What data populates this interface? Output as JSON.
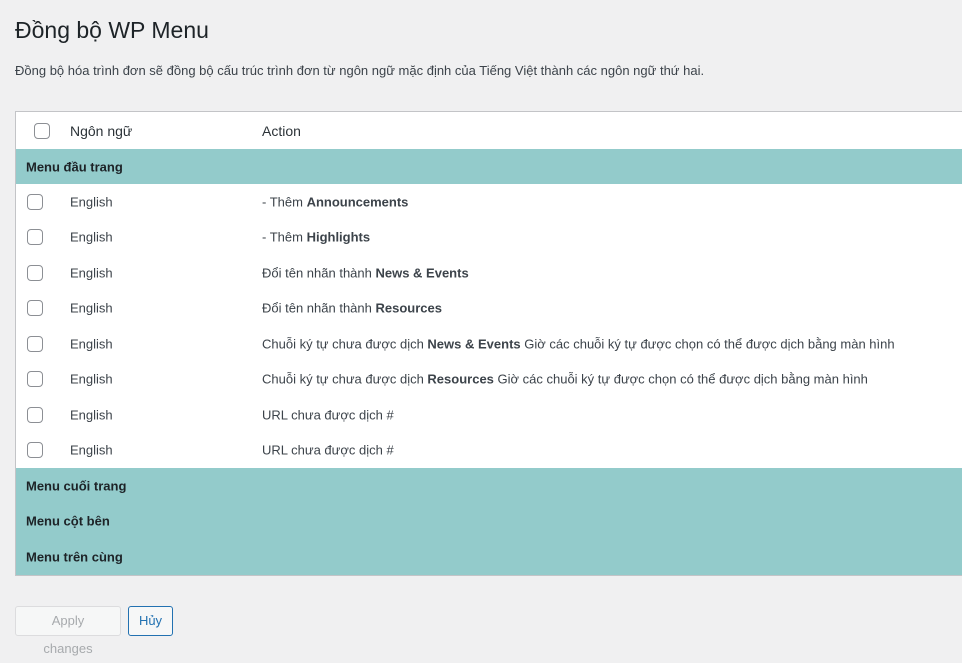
{
  "page": {
    "title": "Đồng bộ WP Menu",
    "description": "Đồng bộ hóa trình đơn sẽ đồng bộ cấu trúc trình đơn từ ngôn ngữ mặc định của Tiếng Việt thành các ngôn ngữ thứ hai."
  },
  "table": {
    "headers": {
      "language": "Ngôn ngữ",
      "action": "Action"
    },
    "groups": [
      {
        "label": "Menu đầu trang",
        "items": [
          {
            "language": "English",
            "action_prefix": "- Thêm ",
            "action_bold": "Announcements",
            "action_suffix": ""
          },
          {
            "language": "English",
            "action_prefix": "- Thêm ",
            "action_bold": "Highlights",
            "action_suffix": ""
          },
          {
            "language": "English",
            "action_prefix": "Đổi tên nhãn thành ",
            "action_bold": "News & Events",
            "action_suffix": ""
          },
          {
            "language": "English",
            "action_prefix": "Đổi tên nhãn thành ",
            "action_bold": "Resources",
            "action_suffix": ""
          },
          {
            "language": "English",
            "action_prefix": "Chuỗi ký tự chưa được dịch ",
            "action_bold": "News & Events",
            "action_suffix": " Giờ các chuỗi ký tự được chọn có thể được dịch bằng màn hình"
          },
          {
            "language": "English",
            "action_prefix": "Chuỗi ký tự chưa được dịch ",
            "action_bold": "Resources",
            "action_suffix": " Giờ các chuỗi ký tự được chọn có thể được dịch bằng màn hình"
          },
          {
            "language": "English",
            "action_prefix": "URL chưa được dịch #",
            "action_bold": "",
            "action_suffix": ""
          },
          {
            "language": "English",
            "action_prefix": "URL chưa được dịch #",
            "action_bold": "",
            "action_suffix": ""
          }
        ]
      },
      {
        "label": "Menu cuối trang",
        "items": []
      },
      {
        "label": "Menu cột bên",
        "items": []
      },
      {
        "label": "Menu trên cùng",
        "items": []
      }
    ]
  },
  "buttons": {
    "apply": "Apply changes",
    "cancel": "Hủy"
  },
  "colors": {
    "group_bg": "#93cbcb",
    "primary": "#2271b1"
  }
}
